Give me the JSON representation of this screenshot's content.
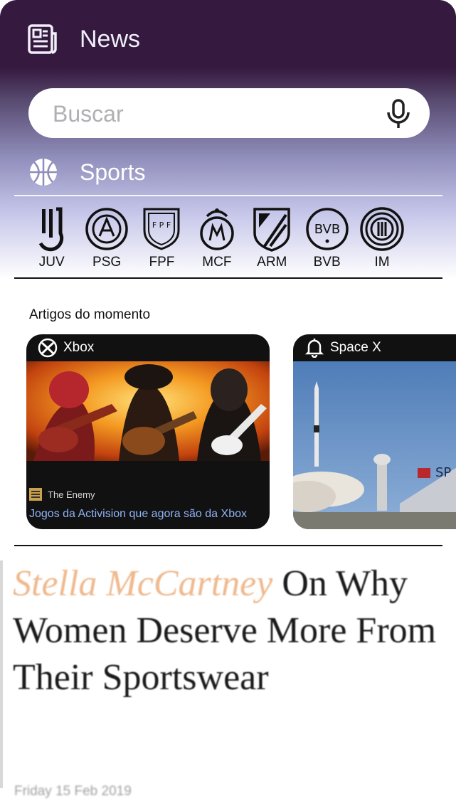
{
  "header": {
    "title": "News",
    "icon": "newspaper-icon"
  },
  "search": {
    "placeholder": "Buscar",
    "value": "",
    "icon": "microphone-icon"
  },
  "category": {
    "label": "Sports",
    "icon": "basketball-icon"
  },
  "teams": [
    {
      "code": "JUV",
      "icon": "juventus-crest-icon"
    },
    {
      "code": "PSG",
      "icon": "psg-crest-icon"
    },
    {
      "code": "FPF",
      "icon": "fpf-crest-icon"
    },
    {
      "code": "MCF",
      "icon": "real-madrid-crest-icon"
    },
    {
      "code": "ARM",
      "icon": "atletico-madrid-crest-icon"
    },
    {
      "code": "BVB",
      "icon": "dortmund-crest-icon"
    },
    {
      "code": "IM",
      "icon": "inter-milan-crest-icon"
    }
  ],
  "trending": {
    "title": "Artigos do momento",
    "cards": [
      {
        "topic": "Xbox",
        "topic_icon": "xbox-icon",
        "source": "The Enemy",
        "source_icon": "the-enemy-logo-icon",
        "headline": "Jogos da Activision que agora são da Xbox"
      },
      {
        "topic": "Space X",
        "topic_icon": "bell-icon"
      }
    ]
  },
  "story": {
    "headline_highlight": "Stella McCartney",
    "headline_rest": " On Why Women Deserve More From Their Sportswear",
    "date": "Friday 15 Feb 2019"
  },
  "colors": {
    "header_bg": "#35193f",
    "card_bg": "#111111",
    "link": "#8fb3f5",
    "highlight": "#f0b98e"
  }
}
